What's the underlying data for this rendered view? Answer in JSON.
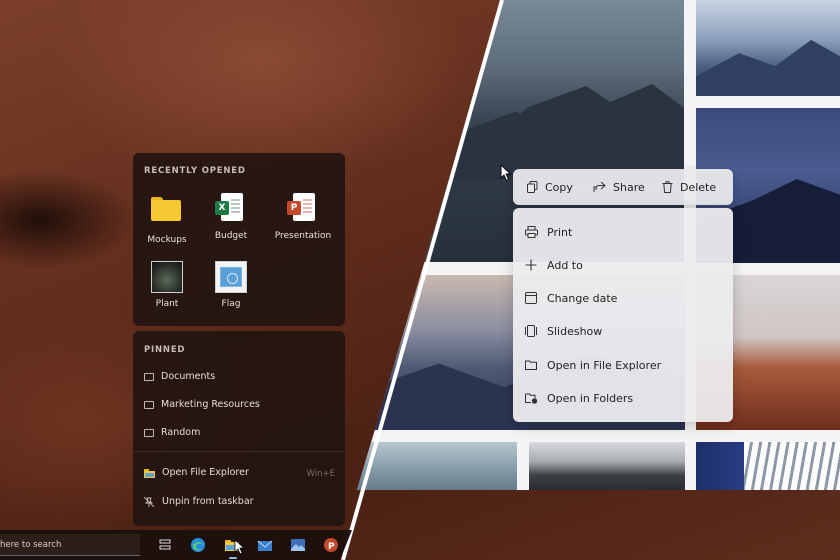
{
  "recent": {
    "title": "RECENTLY OPENED",
    "items": [
      {
        "label": "Mockups",
        "icon": "folder-icon"
      },
      {
        "label": "Budget",
        "icon": "excel-icon"
      },
      {
        "label": "Presentation",
        "icon": "powerpoint-icon"
      },
      {
        "label": "Plant",
        "icon": "image-thumbnail"
      },
      {
        "label": "Flag",
        "icon": "image-thumbnail"
      }
    ]
  },
  "pinned": {
    "title": "PINNED",
    "items": [
      {
        "label": "Documents",
        "icon": "folder-outline-icon"
      },
      {
        "label": "Marketing Resources",
        "icon": "folder-outline-icon"
      },
      {
        "label": "Random",
        "icon": "folder-outline-icon"
      }
    ]
  },
  "actions": {
    "open_explorer": "Open File Explorer",
    "open_explorer_shortcut": "Win+E",
    "unpin": "Unpin from taskbar"
  },
  "taskbar": {
    "search_text": "here to search",
    "icons": [
      "task-view-icon",
      "edge-icon",
      "file-explorer-icon",
      "mail-icon",
      "photos-icon",
      "powerpoint-icon"
    ]
  },
  "context_menu": {
    "top": [
      {
        "label": "Copy",
        "icon": "copy-icon"
      },
      {
        "label": "Share",
        "icon": "share-icon"
      },
      {
        "label": "Delete",
        "icon": "trash-icon"
      }
    ],
    "items": [
      {
        "label": "Print",
        "icon": "printer-icon"
      },
      {
        "label": "Add to",
        "icon": "plus-icon"
      },
      {
        "label": "Change date",
        "icon": "calendar-icon"
      },
      {
        "label": "Slideshow",
        "icon": "slideshow-icon"
      },
      {
        "label": "Open in File Explorer",
        "icon": "folder-outline-icon"
      },
      {
        "label": "Open in Folders",
        "icon": "folder-link-icon"
      }
    ]
  },
  "colors": {
    "panel_bg": "#22140f",
    "menu_bg": "#ececef",
    "folder_yellow": "#f6c832",
    "excel_green": "#1f7a44",
    "powerpoint_orange": "#c4492a"
  }
}
